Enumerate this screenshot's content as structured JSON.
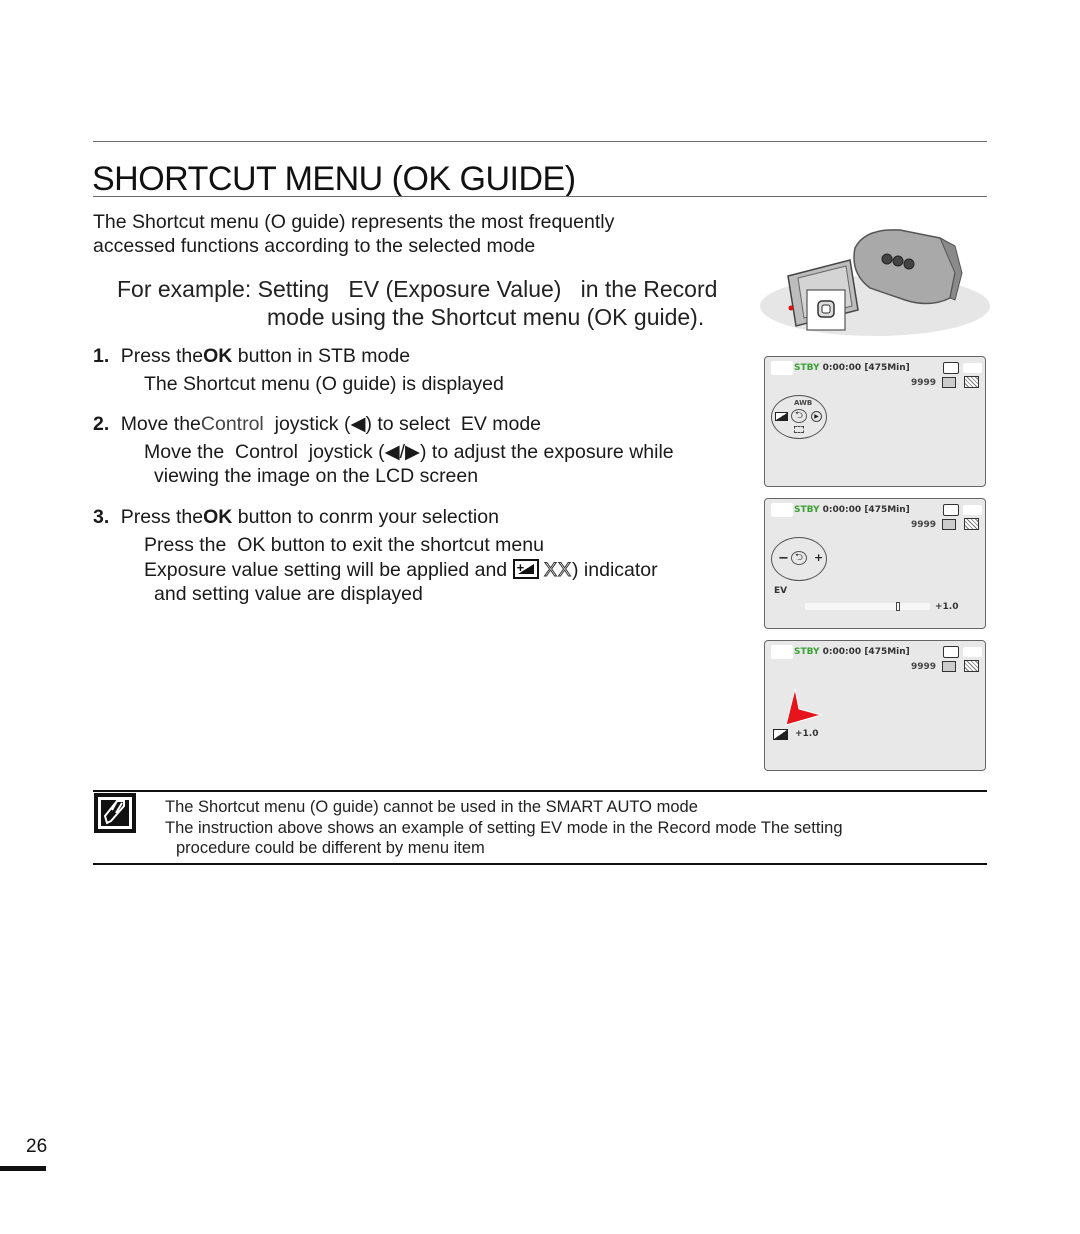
{
  "page": {
    "title": "SHORTCUT MENU (OK GUIDE)",
    "intro": [
      "The Shortcut menu (O guide) represents the most frequently",
      "accessed functions according to the selected mode"
    ],
    "example": {
      "line1": "For example: Setting   EV (Exposure Value)   in the Record",
      "line2": "mode using the Shortcut menu (OK guide)."
    },
    "steps": [
      {
        "num": "1.",
        "pre": "Press the",
        "bold": "OK",
        "post": " button in STB mode",
        "subs": [
          "The Shortcut menu (O guide) is displayed"
        ]
      },
      {
        "num": "2.",
        "pre": "Move the",
        "light": "Control",
        "post": "  joystick (◀) to select  EV mode",
        "subs": [
          "Move the  Control  joystick (◀/▶) to adjust the exposure while",
          "viewing the image on the LCD screen"
        ]
      },
      {
        "num": "3.",
        "pre": "Press the",
        "bold": "OK",
        "post": " button to conrm your selection",
        "subs": [
          "Press the  OK button to exit the shortcut menu",
          "Exposure value setting will be applied and",
          "XX",
          ") indicator",
          "and setting value are displayed"
        ]
      }
    ],
    "note": {
      "icon": "note-pencil-icon",
      "lines": [
        "The Shortcut menu (O guide) cannot be used in the SMART AUTO mode",
        "The instruction above shows an example of setting EV mode in the Record mode The setting",
        "procedure could be different by menu item"
      ]
    },
    "page_number": "26"
  },
  "lcd": {
    "stby": "STBY",
    "time": "0:00:00",
    "remaining": "[475Min]",
    "photo_count": "9999",
    "ev_label": "EV",
    "ev_value": "+1.0",
    "ev_slider_fraction": 0.75,
    "return_glyph": "⮌",
    "minus": "−",
    "plus": "+",
    "play": "▶",
    "wb": "AWB"
  },
  "colors": {
    "stby_green": "#3aa035",
    "arrow_red": "#e8141b",
    "lcd_bg": "#e8e8e8"
  }
}
